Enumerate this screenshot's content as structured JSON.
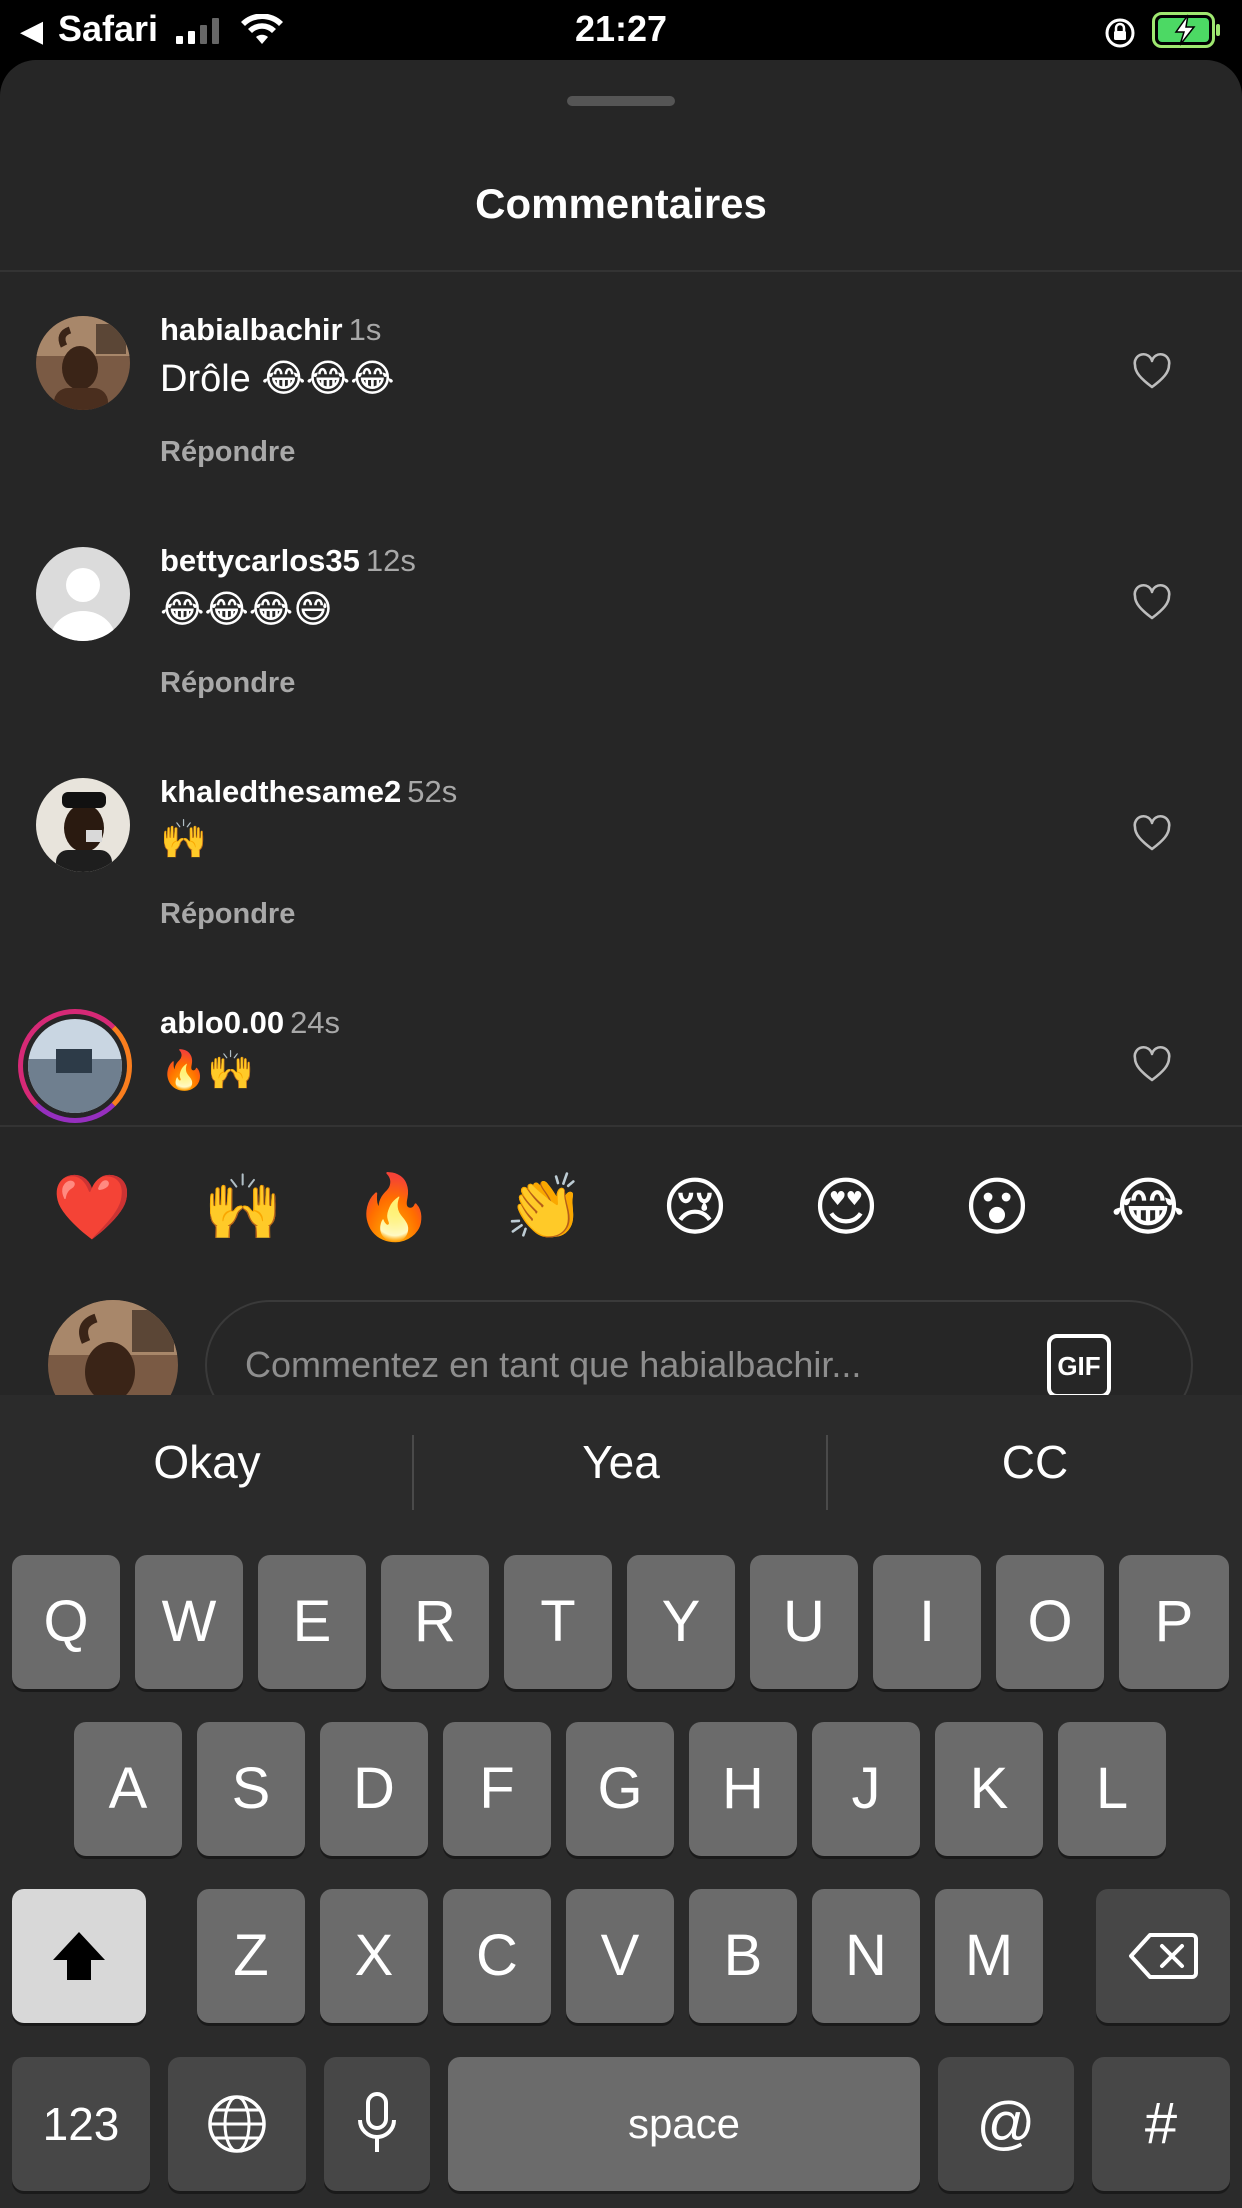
{
  "status_bar": {
    "back_app": "Safari",
    "time": "21:27",
    "back_arrow": "◀"
  },
  "sheet": {
    "title": "Commentaires"
  },
  "comments": [
    {
      "user": "habialbachir",
      "time": "1s",
      "text": "Drôle 😂😂😂",
      "reply": "Répondre"
    },
    {
      "user": "bettycarlos35",
      "time": "12s",
      "text": "😂😂😂😅",
      "reply": "Répondre"
    },
    {
      "user": "khaledthesame2",
      "time": "52s",
      "text": "🙌",
      "reply": "Répondre"
    },
    {
      "user": "ablo0.00",
      "time": "24s",
      "text": "🔥🙌",
      "reply": ""
    }
  ],
  "quick_emojis": [
    "❤️",
    "🙌",
    "🔥",
    "👏",
    "😢",
    "😍",
    "😮",
    "😂"
  ],
  "composer": {
    "placeholder": "Commentez en tant que habialbachir...",
    "gif_label": "GIF"
  },
  "keyboard": {
    "suggestions": [
      "Okay",
      "Yea",
      "CC"
    ],
    "row1": [
      "Q",
      "W",
      "E",
      "R",
      "T",
      "Y",
      "U",
      "I",
      "O",
      "P"
    ],
    "row2": [
      "A",
      "S",
      "D",
      "F",
      "G",
      "H",
      "J",
      "K",
      "L"
    ],
    "row3": [
      "Z",
      "X",
      "C",
      "V",
      "B",
      "N",
      "M"
    ],
    "numbers_label": "123",
    "space_label": "space",
    "at_label": "@",
    "hash_label": "#"
  },
  "colors": {
    "sheet_bg": "#262626",
    "keyboard_bg": "#2b2b2b",
    "key_bg": "#6b6b6b",
    "story_ring": "#d62976"
  }
}
